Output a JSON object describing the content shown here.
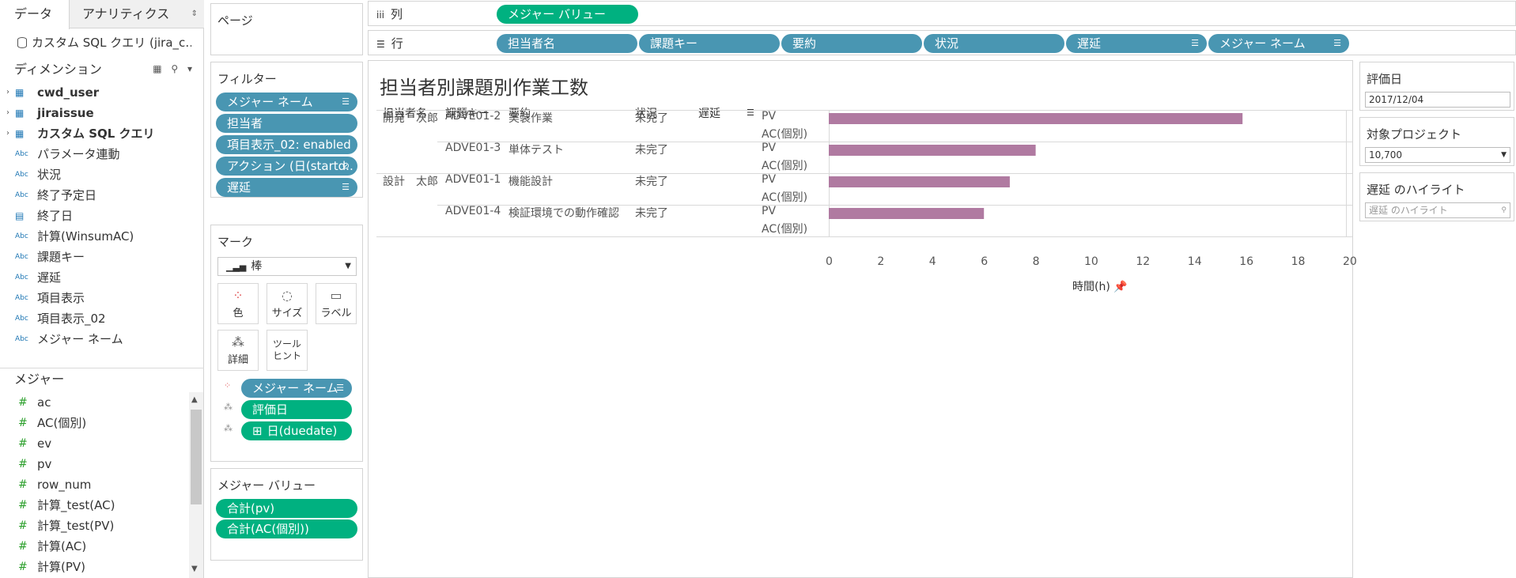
{
  "data_pane": {
    "tab_data": "データ",
    "tab_analytics": "アナリティクス",
    "datasource": "カスタム SQL クエリ (jira_c…",
    "dimensions_header": "ディメンション",
    "dimensions": [
      {
        "label": "cwd_user",
        "type": "table"
      },
      {
        "label": "jiraissue",
        "type": "table"
      },
      {
        "label": "カスタム SQL クエリ",
        "type": "table"
      },
      {
        "label": "パラメータ連動",
        "type": "abc"
      },
      {
        "label": "状況",
        "type": "abc"
      },
      {
        "label": "終了予定日",
        "type": "abc"
      },
      {
        "label": "終了日",
        "type": "date"
      },
      {
        "label": "計算(WinsumAC)",
        "type": "abc"
      },
      {
        "label": "課題キー",
        "type": "abc"
      },
      {
        "label": "遅延",
        "type": "abc"
      },
      {
        "label": "項目表示",
        "type": "abc"
      },
      {
        "label": "項目表示_02",
        "type": "abc"
      },
      {
        "label": "メジャー ネーム",
        "type": "abc"
      }
    ],
    "measures_header": "メジャー",
    "measures": [
      "ac",
      "AC(個別)",
      "ev",
      "pv",
      "row_num",
      "計算_test(AC)",
      "計算_test(PV)",
      "計算(AC)",
      "計算(PV)"
    ]
  },
  "pages": {
    "title": "ページ"
  },
  "filters": {
    "title": "フィルター",
    "items": [
      "メジャー ネーム",
      "担当者",
      "項目表示_02: enabled",
      "アクション (日(startd..",
      "遅延"
    ]
  },
  "marks": {
    "title": "マーク",
    "mark_type": "棒",
    "buttons": {
      "color": "色",
      "size": "サイズ",
      "label": "ラベル",
      "detail": "詳細",
      "tooltip": "ツール\nヒント"
    },
    "pills": [
      "メジャー ネーム",
      "評価日",
      "日(duedate)"
    ]
  },
  "measure_values": {
    "title": "メジャー バリュー",
    "items": [
      "合計(pv)",
      "合計(AC(個別))"
    ]
  },
  "columns_shelf": {
    "label": "列",
    "pills": [
      "メジャー バリュー"
    ]
  },
  "rows_shelf": {
    "label": "行",
    "pills": [
      "担当者名",
      "課題キー",
      "要約",
      "状況",
      "遅延",
      "メジャー ネーム"
    ]
  },
  "viz": {
    "title": "担当者別課題別作業工数",
    "headers": [
      "担当者名",
      "課題キー",
      "要約",
      "状況",
      "遅延"
    ],
    "axis_title": "時間(h)",
    "ticks": [
      "0",
      "2",
      "4",
      "6",
      "8",
      "10",
      "12",
      "14",
      "16",
      "18",
      "20"
    ],
    "rows": [
      {
        "assignee": "開発　次郎",
        "key": "ADVE01-2",
        "summary": "実装作業",
        "status": "未完了",
        "measures": [
          "PV",
          "AC(個別)"
        ]
      },
      {
        "assignee": "",
        "key": "ADVE01-3",
        "summary": "単体テスト",
        "status": "未完了",
        "measures": [
          "PV",
          "AC(個別)"
        ]
      },
      {
        "assignee": "設計　太郎",
        "key": "ADVE01-1",
        "summary": "機能設計",
        "status": "未完了",
        "measures": [
          "PV",
          "AC(個別)"
        ]
      },
      {
        "assignee": "",
        "key": "ADVE01-4",
        "summary": "検証環境での動作確認",
        "status": "未完了",
        "measures": [
          "PV",
          "AC(個別)"
        ]
      }
    ]
  },
  "chart_data": {
    "type": "bar",
    "title": "担当者別課題別作業工数",
    "categories": [
      "ADVE01-2 PV",
      "ADVE01-3 PV",
      "ADVE01-1 PV",
      "ADVE01-4 PV"
    ],
    "values": [
      16,
      8,
      7,
      6
    ],
    "xlabel": "時間(h)",
    "xlim": [
      0,
      20
    ],
    "color": "#b07aa1"
  },
  "params": {
    "eval_date_label": "評価日",
    "eval_date_value": "2017/12/04",
    "project_label": "対象プロジェクト",
    "project_value": "10,700",
    "highlight_label": "遅延 のハイライト",
    "highlight_placeholder": "遅延 のハイライト"
  },
  "colors": {
    "blue_pill": "#4996b2",
    "green_pill": "#00b180",
    "bar": "#b07aa1"
  }
}
